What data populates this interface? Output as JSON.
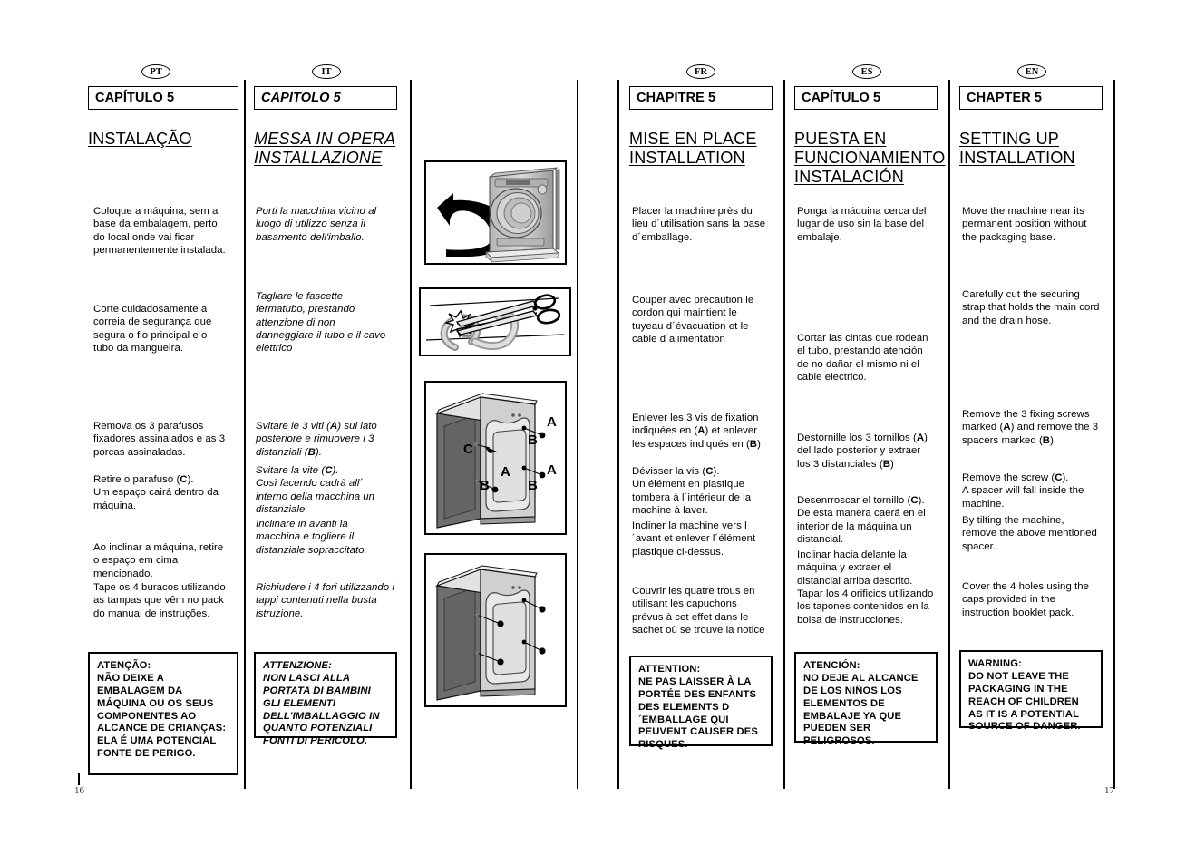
{
  "document": {
    "type": "washing-machine-instruction-manual",
    "spread": "two-page multilingual manual spread",
    "left_page_number": "16",
    "right_page_number": "17"
  },
  "columns": [
    {
      "id": "pt",
      "lang_badge": "PT",
      "chapter_label": "CAPÍTULO 5",
      "title_lines": [
        "INSTALAÇÃO"
      ],
      "italic": false,
      "paragraphs": [
        "Coloque a máquina, sem a base da embalagem, perto do local onde vai ficar permanentemente instalada.",
        "Corte cuidadosamente a correia de segurança que segura o fio principal e o tubo da mangueira.",
        "Remova os 3 parafusos fixadores assinalados e as 3 porcas assinaladas.",
        "Retire o parafuso (C). Um espaço cairá dentro da máquina.",
        "Ao inclinar a máquina, retire o espaço em cima mencionado.",
        "Tape os 4 buracos utilizando as tampas que vêm no pack do manual de instruções."
      ],
      "warning": "ATENÇÃO:\nNÃO DEIXE A EMBALAGEM DA MÁQUINA OU OS SEUS COMPONENTES AO ALCANCE DE CRIANÇAS: ELA É UMA POTENCIAL FONTE DE PERIGO."
    },
    {
      "id": "it",
      "lang_badge": "IT",
      "chapter_label": "CAPITOLO 5",
      "title_lines": [
        "MESSA IN OPERA",
        "INSTALLAZIONE"
      ],
      "italic": true,
      "paragraphs": [
        "Porti la macchina vicino al luogo di utilizzo senza il basamento dell'imballo.",
        "Tagliare le fascette fermatubo, prestando attenzione di non danneggiare il tubo e il cavo elettrico",
        "Svitare le 3 viti (A) sul lato posteriore e rimuovere i 3 distanziali (B).",
        "Svitare la vite (C). Così facendo cadrà all´ interno della macchina un distanziale.",
        "Inclinare in avanti la macchina e togliere il distanziale sopraccitato.",
        "Richiudere i 4 fori utilizzando i tappi contenuti nella busta istruzione."
      ],
      "warning": "ATTENZIONE:\nNON LASCI ALLA PORTATA DI BAMBINI GLI ELEMENTI DELL'IMBALLAGGIO IN QUANTO POTENZIALI FONTI DI PERICOLO."
    },
    {
      "id": "fr",
      "lang_badge": "FR",
      "chapter_label": "CHAPITRE 5",
      "title_lines": [
        "MISE EN PLACE",
        "INSTALLATION"
      ],
      "italic": false,
      "paragraphs": [
        "Placer la machine près du lieu d´utilisation sans la base d´emballage.",
        "Couper avec précaution le cordon qui maintient le tuyeau d´évacuation et le cable d´alimentation",
        "Enlever les 3 vis de fixation indiquées en (A) et enlever les espaces indiqués en (B)",
        "Dévisser la vis (C). Un élément en plastique tombera à l´intérieur de la machine à laver.",
        "Incliner la machine vers l´avant et enlever l´élément plastique ci-dessus.",
        "Couvrir les quatre trous en utilisant les capuchons prévus à cet effet dans le sachet où se trouve la notice"
      ],
      "warning": "ATTENTION:\nNE PAS LAISSER À LA PORTÉE DES ENFANTS DES ELEMENTS D´EMBALLAGE QUI PEUVENT CAUSER DES RISQUES."
    },
    {
      "id": "es",
      "lang_badge": "ES",
      "chapter_label": "CAPÍTULO 5",
      "title_lines": [
        "PUESTA EN",
        "FUNCIONAMIENTO",
        "INSTALACIÓN"
      ],
      "italic": false,
      "paragraphs": [
        "Ponga la máquina cerca del lugar de uso sin la base del embalaje.",
        "Cortar las cintas que rodean el tubo, prestando atención de no dañar el mismo ni el cable electrico.",
        "Destornille los 3 tornillos (A) del lado posterior y extraer los 3 distanciales (B)",
        "Desenrroscar el tornillo (C). De esta manera caerá en el interior de la máquina un distancial.",
        "Inclinar hacia delante la máquina y extraer el distancial  arriba descrito.",
        "Tapar los 4 orificios utilizando los tapones contenidos en la bolsa de instrucciones."
      ],
      "warning": "ATENCIÓN:\nNO DEJE AL ALCANCE DE LOS NIÑOS LOS ELEMENTOS DE EMBALAJE YA QUE PUEDEN SER PELIGROSOS."
    },
    {
      "id": "en",
      "lang_badge": "EN",
      "chapter_label": "CHAPTER 5",
      "title_lines": [
        "SETTING UP",
        "INSTALLATION"
      ],
      "italic": false,
      "paragraphs": [
        "Move the machine near its permanent position without the packaging base.",
        "Carefully cut the securing strap that holds the main cord and the drain hose.",
        "Remove the 3 fixing screws marked (A) and remove the 3 spacers marked (B)",
        "Remove the screw  (C). A spacer will fall inside the machine.",
        "By tilting the machine, remove the above mentioned spacer.",
        "Cover the 4 holes using the caps provided in the instruction booklet pack."
      ],
      "warning": "WARNING:\nDO NOT LEAVE THE PACKAGING IN THE REACH OF CHILDREN AS IT IS A POTENTIAL SOURCE OF DANGER."
    }
  ],
  "illustrations": [
    {
      "id": "fig-move-machine",
      "caption_semantics": "washing machine being moved off its packaging base, curved arrow pointing up-left"
    },
    {
      "id": "fig-cut-strap",
      "caption_semantics": "scissors cutting the securing strap around the drain hose and power cable"
    },
    {
      "id": "fig-rear-screws",
      "caption_semantics": "rear of machine showing transit screws and spacers",
      "callouts": [
        "A",
        "B",
        "C",
        "A",
        "A",
        "B",
        "B",
        "B"
      ]
    },
    {
      "id": "fig-cover-holes",
      "caption_semantics": "rear of machine showing 4 holes covered with caps"
    }
  ],
  "colors": {
    "ink": "#000000",
    "paper": "#ffffff",
    "machine_body_light": "#d7d7d7",
    "machine_body_dark": "#6e6e6e",
    "machine_mid": "#a8a8a8"
  }
}
